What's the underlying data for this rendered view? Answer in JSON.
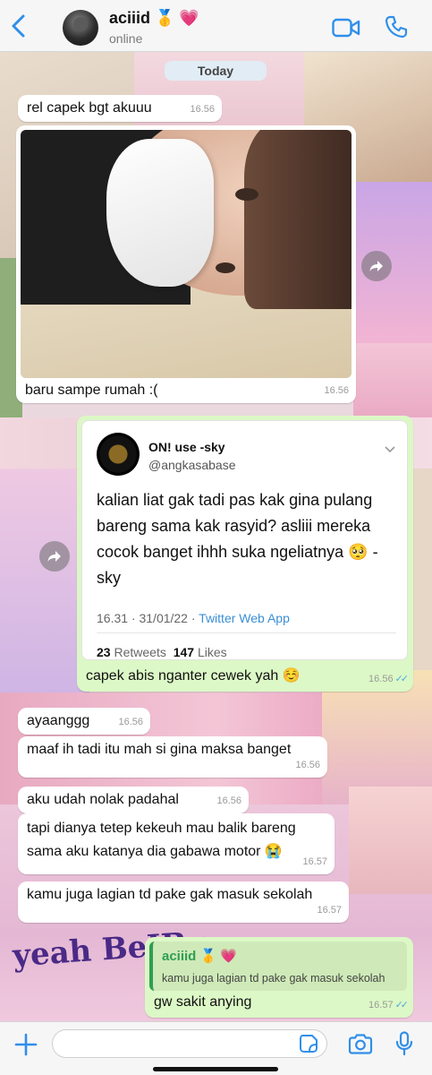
{
  "header": {
    "contact_name": "aciiid 🥇 💗",
    "status": "online",
    "icons": [
      "back-chevron-icon",
      "video-call-icon",
      "phone-call-icon"
    ]
  },
  "date_separator": "Today",
  "messages": [
    {
      "dir": "in",
      "text": "rel capek bgt akuuu",
      "time": "16.56"
    },
    {
      "dir": "in",
      "type": "photo",
      "caption": "baru sampe rumah :(",
      "time": "16.56"
    },
    {
      "dir": "out",
      "type": "tweet",
      "time": "16.56",
      "ticks": "✓✓",
      "tweet": {
        "name": "ON! use -sky",
        "handle": "@angkasabase",
        "text": "kalian liat gak tadi pas kak gina pulang bareng sama kak rasyid? asliii mereka cocok banget ihhh suka ngeliatnya 🥺 -sky",
        "date": "16.31 · 31/01/22 · ",
        "source": "Twitter Web App",
        "retweets": "23",
        "retweets_label": "Retweets",
        "likes": "147",
        "likes_label": "Likes"
      },
      "caption": "capek abis nganter cewek yah ☺️"
    },
    {
      "dir": "in",
      "text": "ayaanggg",
      "time": "16.56"
    },
    {
      "dir": "in",
      "text": "maaf ih tadi itu mah si gina maksa banget",
      "time": "16.56"
    },
    {
      "dir": "in",
      "text": "aku udah nolak padahal",
      "time": "16.56"
    },
    {
      "dir": "in",
      "text": "tapi dianya tetep kekeuh mau balik bareng sama aku katanya dia gabawa motor 😭",
      "time": "16.57"
    },
    {
      "dir": "in",
      "text": "kamu juga lagian td pake gak masuk sekolah",
      "time": "16.57"
    },
    {
      "dir": "out",
      "type": "reply",
      "quote_name": "aciiid 🥇 💗",
      "quote_text": "kamu juga lagian td pake gak masuk sekolah",
      "text": "gw sakit anying",
      "time": "16.57",
      "ticks": "✓✓"
    }
  ],
  "wallpaper_text": "yeah BeIBy",
  "composer": {
    "placeholder": "",
    "value": ""
  },
  "colors": {
    "accent": "#3b8fd6",
    "outgoing": "#dcf8c6",
    "incoming": "#ffffff",
    "read_ticks": "#4fa8e0"
  }
}
